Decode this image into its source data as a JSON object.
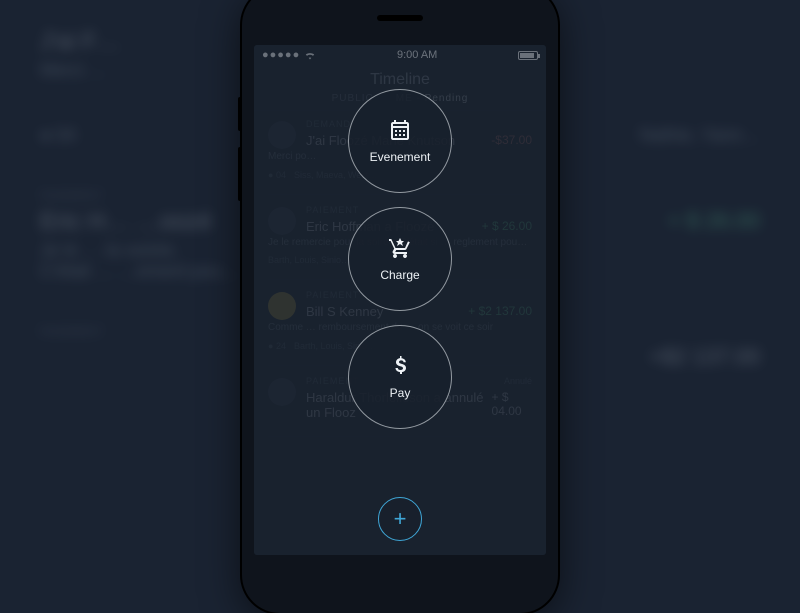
{
  "statusbar": {
    "signal": "●●●●●",
    "wifi": "wifi",
    "time": "9:00 AM"
  },
  "header": {
    "title": "Timeline"
  },
  "tabs": {
    "public": "PUBLIC",
    "me": "ME - Pending"
  },
  "actions": {
    "event": "Evenement",
    "charge": "Charge",
    "pay": "Pay"
  },
  "fab": {
    "glyph": "+"
  },
  "feed": [
    {
      "type": "DEMANDE",
      "status": "",
      "who": "J'ai Floozé Marie Knutson",
      "amount": "-$37.00",
      "desc": "Merci po…",
      "count": "04",
      "names": "Siss, Maeva, West…"
    },
    {
      "type": "PAIEMENT",
      "status": "",
      "who": "Eric Hoffman a Floozé",
      "amount": "+ $ 26.00",
      "desc": "Je le remercie pour la soirée. C'était si … reglement pou…",
      "count": "",
      "names": "Barth, Louis, Sinio…"
    },
    {
      "type": "PAIEMENT",
      "status": "",
      "who": "Bill S Kenney",
      "amount": "+ $2 137.00",
      "desc": "Comme … remboursement du … on se voit ce soir",
      "count": "24",
      "names": "Barth, Louis, Sinio…"
    },
    {
      "type": "PAIEMENT",
      "status": "Annulé",
      "who": "Haraldur Thorleifsson a annulé un Flooz",
      "amount": "+ $ 04.00",
      "desc": "",
      "count": "",
      "names": ""
    }
  ],
  "backdrop": [
    {
      "tag": "",
      "line1": "J'ai F…",
      "line2": "Merci …",
      "amount": ""
    },
    {
      "tag": "",
      "line1": "04",
      "line2": "",
      "amount": "Nathie, Yann…"
    },
    {
      "tag": "PAIEMENT",
      "line1": "Eric H…          …oozé",
      "line2": "Je le …    la soirée.\nC'était …  …ement pou…",
      "amount": "+ $ 26.00"
    },
    {
      "tag": "PAIEMENT",
      "line1": "",
      "line2": "",
      "amount": "+$2 137.00"
    }
  ]
}
